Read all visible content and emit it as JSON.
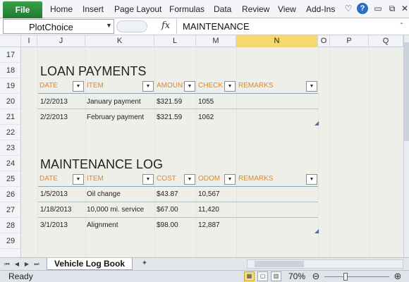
{
  "ribbon": {
    "file_label": "File",
    "tabs": [
      "Home",
      "Insert",
      "Page Layout",
      "Formulas",
      "Data",
      "Review",
      "View",
      "Add-Ins"
    ]
  },
  "formula_bar": {
    "name_box": "PlotChoice",
    "fx_label": "fx",
    "value": "MAINTENANCE"
  },
  "columns": [
    "I",
    "J",
    "K",
    "L",
    "M",
    "N",
    "O",
    "P",
    "Q"
  ],
  "selected_column": "N",
  "rows": [
    "17",
    "18",
    "19",
    "20",
    "21",
    "22",
    "23",
    "24",
    "25",
    "26",
    "27",
    "28",
    "29"
  ],
  "loan_payments": {
    "title": "LOAN PAYMENTS",
    "headers": [
      "DATE",
      "ITEM",
      "AMOUNT",
      "CHECK #",
      "REMARKS"
    ],
    "rows": [
      [
        "1/2/2013",
        "January payment",
        "$321.59",
        "1055"
      ],
      [
        "2/2/2013",
        "February payment",
        "$321.59",
        "1062"
      ]
    ]
  },
  "maintenance_log": {
    "title": "MAINTENANCE LOG",
    "headers": [
      "DATE",
      "ITEM",
      "COST",
      "ODOM",
      "REMARKS"
    ],
    "rows": [
      [
        "1/5/2013",
        "Oil change",
        "$43.87",
        "10,567"
      ],
      [
        "1/18/2013",
        "10,000 mi. service",
        "$67.00",
        "11,420"
      ],
      [
        "3/1/2013",
        "Alignment",
        "$98.00",
        "12,887"
      ]
    ]
  },
  "sheet_tab": "Vehicle Log Book",
  "status": {
    "text": "Ready",
    "zoom": "70%"
  },
  "colors": {
    "header_accent": "#e0882a",
    "file_tab": "#2c8a3c",
    "selected_column": "#f5d96e"
  },
  "icons": {
    "help": "question-circle-icon",
    "fx": "function-icon",
    "filter": "dropdown-arrow-icon"
  }
}
